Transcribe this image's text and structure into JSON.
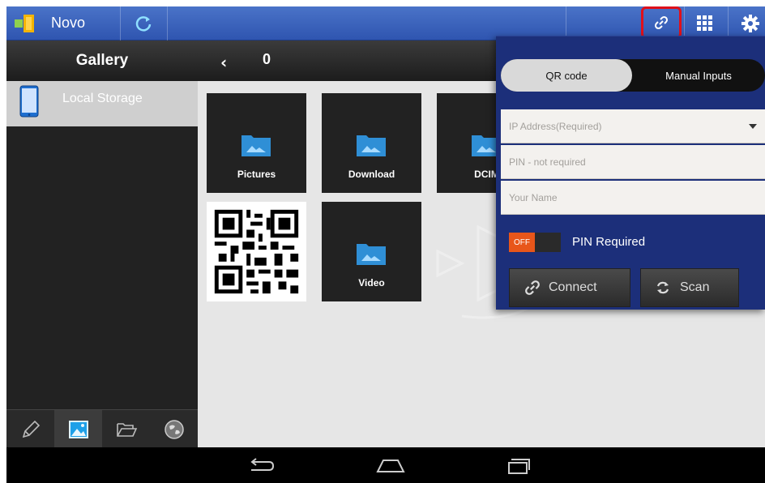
{
  "app": {
    "title": "Novo"
  },
  "sidebar": {
    "header": "Gallery",
    "storage_label": "Local Storage"
  },
  "gallery": {
    "path": "0",
    "back_chevron": "‹",
    "folders": [
      {
        "label": "Pictures"
      },
      {
        "label": "Download"
      },
      {
        "label": "DCIM"
      },
      {
        "label": "Video"
      }
    ]
  },
  "panel": {
    "tab_qr": "QR code",
    "tab_manual": "Manual Inputs",
    "ip_placeholder": "IP Address(Required)",
    "pin_placeholder": "PIN - not required",
    "name_placeholder": "Your Name",
    "toggle_state": "OFF",
    "pin_required_label": "PIN Required",
    "connect_label": "Connect",
    "scan_label": "Scan"
  },
  "colors": {
    "action_bar": "#3a62bd",
    "panel_bg": "#1c2f7a",
    "highlight": "#e0101a",
    "toggle_off": "#e8561a"
  }
}
